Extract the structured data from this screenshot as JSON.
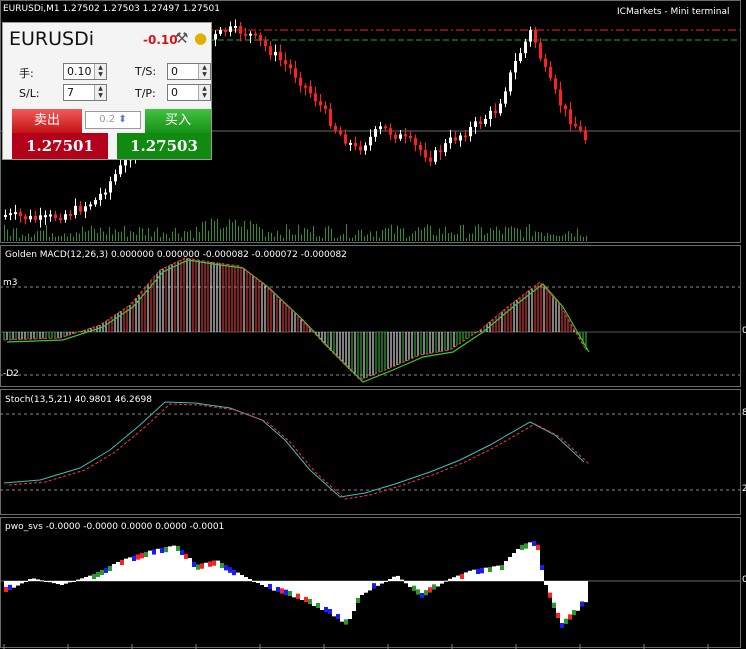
{
  "header": {
    "symbol_info": "EURUSDi,M1  1.27502 1.27503 1.27497 1.27501",
    "broker": "ICMarkets - Mini terminal"
  },
  "panel": {
    "symbol": "EURUSDi",
    "change": "-0.10",
    "tools_icon": "tools-icon",
    "coin_icon": "coin-icon",
    "lots_label": "手:",
    "lots_value": "0.10",
    "ts_label": "T/S:",
    "ts_value": "0",
    "sl_label": "S/L:",
    "sl_value": "7",
    "tp_label": "T/P:",
    "tp_value": "0",
    "sell_label": "卖出",
    "buy_label": "买入",
    "spread": "0.2",
    "sell_price": "1.27501",
    "buy_price": "1.27503"
  },
  "indicators": {
    "macd_title": "Golden MACD(12,26,3) 0.000000 0.000000 -0.000082 -0.000072 -0.000082",
    "macd_level_top": "m3",
    "macd_level_bottom": "-D2",
    "stoch_title": "Stoch(13,5,21) 40.9801 46.2698",
    "pwo_title": "pwo_svs -0.0000 -0.0000 0.0000 0.0000 -0.0001"
  },
  "right_axis": {
    "macd_mid": "0",
    "stoch_top": "8",
    "stoch_bottom": "2",
    "pwo_mid": "0"
  },
  "colors": {
    "bull": "#ffffff",
    "bear": "#ff2020",
    "volume": "#2f8f2f",
    "macd_line": "#ff3333",
    "signal_line": "#33cc33",
    "stoch_main": "#3fbfbf",
    "stoch_signal": "#ff3333",
    "ask_line": "#ff2020",
    "bid_line": "#1fa51f"
  }
}
